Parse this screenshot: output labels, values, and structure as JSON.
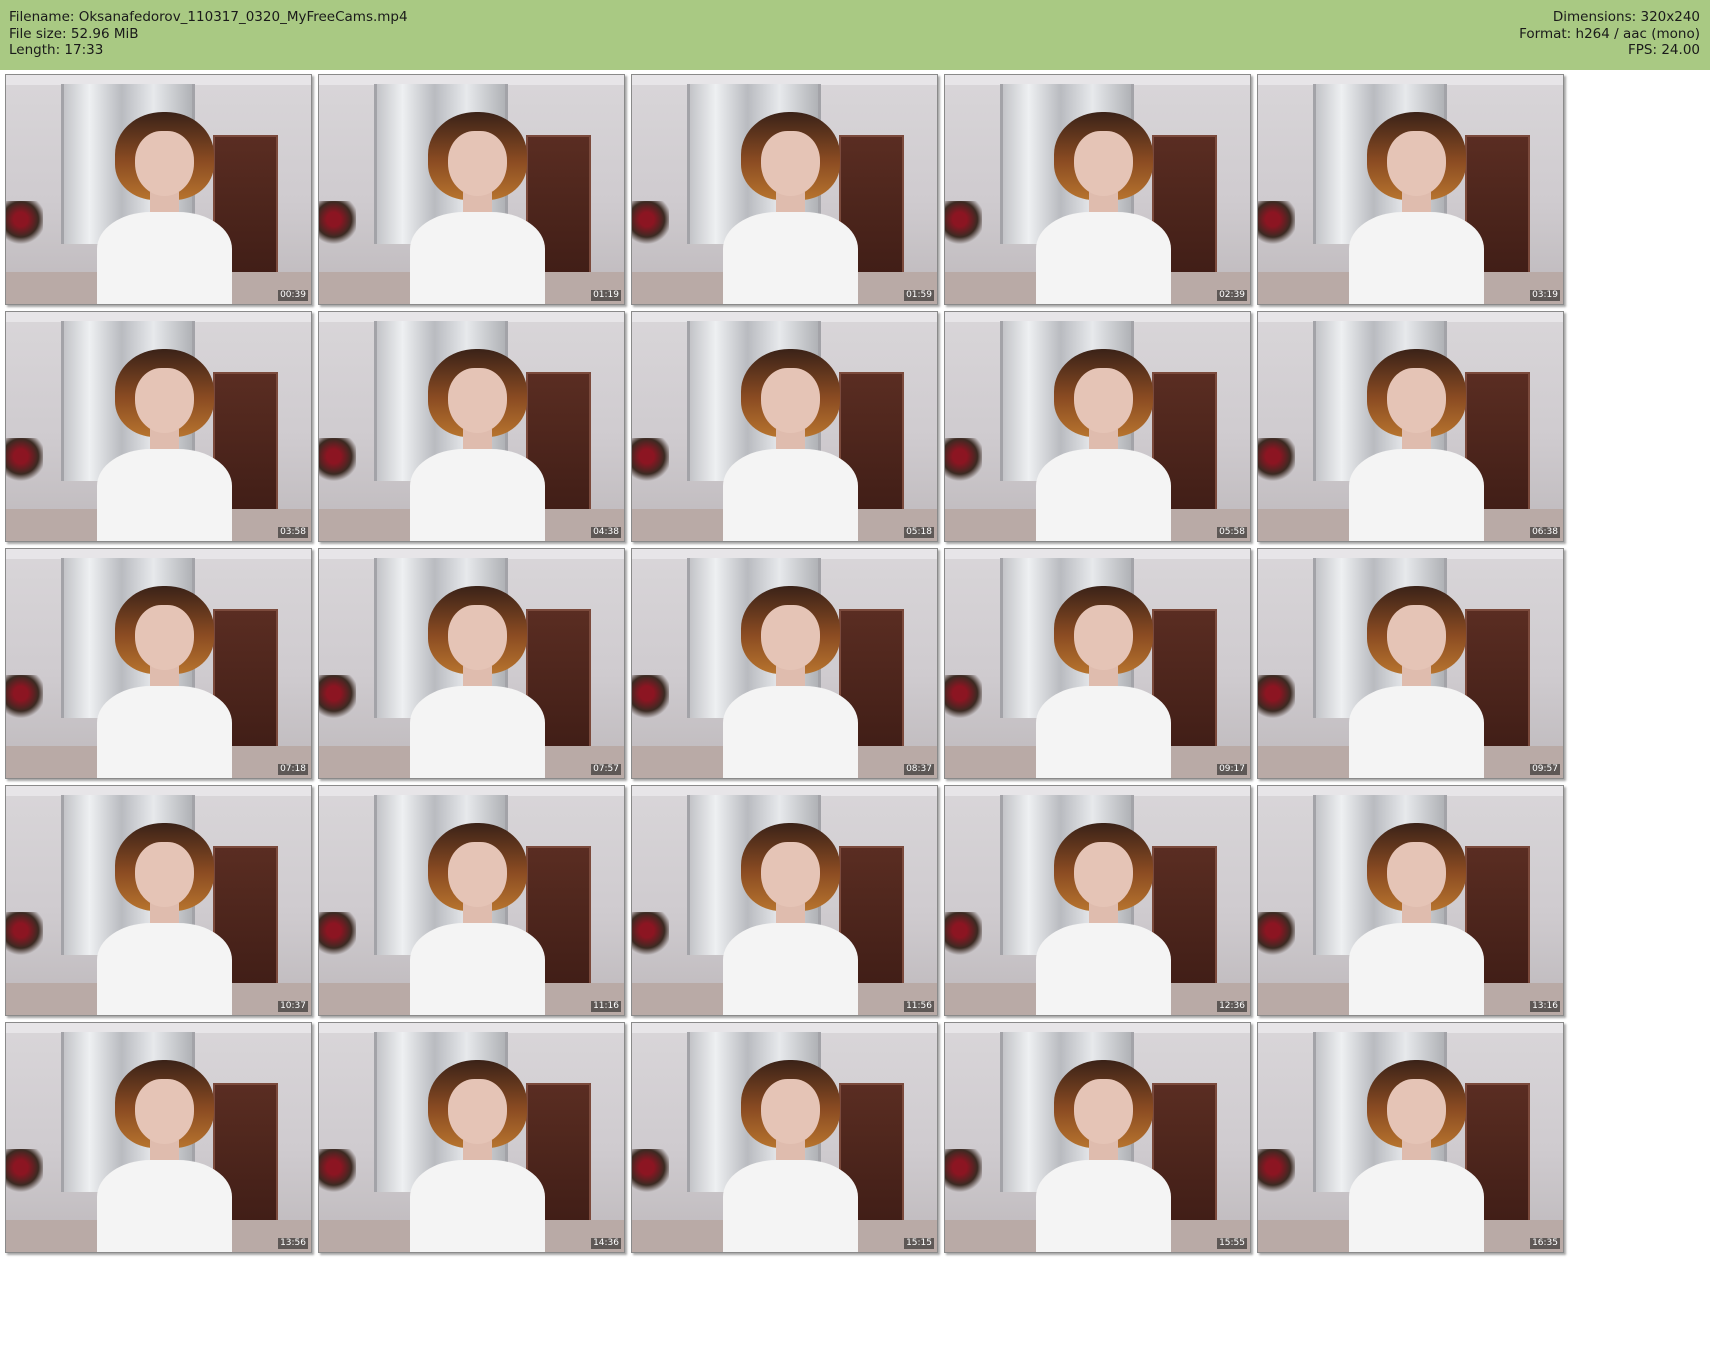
{
  "meta": {
    "filename": "Filename: Oksanafedorov_110317_0320_MyFreeCams.mp4",
    "file_size": "File size: 52.96 MiB",
    "length": "Length: 17:33",
    "dimensions": "Dimensions: 320x240",
    "format": "Format: h264 / aac (mono)",
    "fps": "FPS: 24.00"
  },
  "thumbnails": [
    {
      "time": "00:39"
    },
    {
      "time": "01:19"
    },
    {
      "time": "01:59"
    },
    {
      "time": "02:39"
    },
    {
      "time": "03:19"
    },
    {
      "time": "03:58"
    },
    {
      "time": "04:38"
    },
    {
      "time": "05:18"
    },
    {
      "time": "05:58"
    },
    {
      "time": "06:38"
    },
    {
      "time": "07:18"
    },
    {
      "time": "07:57"
    },
    {
      "time": "08:37"
    },
    {
      "time": "09:17"
    },
    {
      "time": "09:57"
    },
    {
      "time": "10:37"
    },
    {
      "time": "11:16"
    },
    {
      "time": "11:56"
    },
    {
      "time": "12:36"
    },
    {
      "time": "13:16"
    },
    {
      "time": "13:56"
    },
    {
      "time": "14:36"
    },
    {
      "time": "15:15"
    },
    {
      "time": "15:55"
    },
    {
      "time": "16:35"
    }
  ],
  "colors": {
    "header_bg": "#a9c983",
    "timestamp_bg": "#1a1a1a",
    "timestamp_text": "#ffffff"
  }
}
